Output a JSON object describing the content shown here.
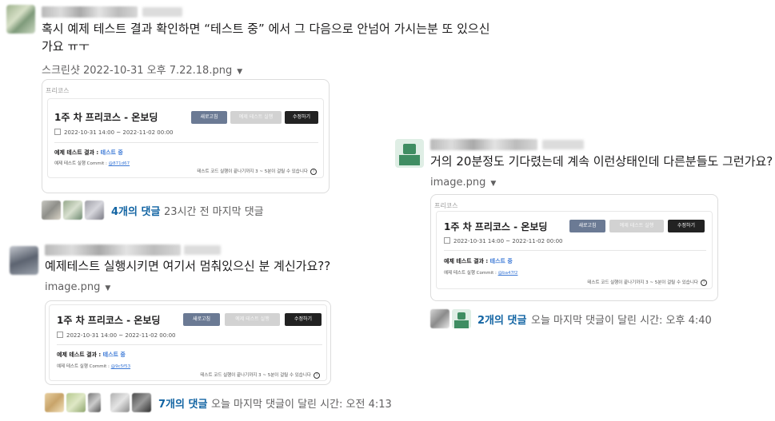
{
  "messages": [
    {
      "text_line1": "혹시 예제 테스트 결과 확인하면 “테스트 중” 에서 그 다음으로 안넘어 가시는분 또 있으신",
      "text_line2": "가요 ㅠㅜ",
      "file_name": "스크린샷 2022-10-31 오후 7.22.18.png",
      "card": {
        "section": "프리코스",
        "title": "1주 차 프리코스 - 온보딩",
        "btn_refresh": "새로고침",
        "btn_run": "예제 테스트 실행",
        "btn_edit": "수정하기",
        "date_range": "2022-10-31 14:00 ~ 2022-11-02 00:00",
        "result_label": "예제 테스트 결과 :",
        "result_value": "테스트 중",
        "commit_label": "예제 테스트 실행 Commit :",
        "commit_hash": "@871d67",
        "footer": "테스트 코드 실행이 끝나기까지 3 ~ 5분이 걸릴 수 있습니다"
      },
      "replies": {
        "count": "4개의 댓글",
        "meta": "23시간 전 마지막 댓글"
      }
    },
    {
      "text_line1": "예제테스트 실행시키면 여기서 멈춰있으신 분 계신가요??",
      "file_name": "image.png",
      "card": {
        "title": "1주 차 프리코스 - 온보딩",
        "btn_refresh": "새로고침",
        "btn_run": "예제 테스트 실행",
        "btn_edit": "수정하기",
        "date_range": "2022-10-31 14:00 ~ 2022-11-02 00:00",
        "result_label": "예제 테스트 결과 :",
        "result_value": "테스트 중",
        "commit_label": "예제 테스트 실행 Commit :",
        "commit_hash": "@9c5f53",
        "footer": "테스트 코드 실행이 끝나기까지 3 ~ 5분이 걸릴 수 있습니다"
      },
      "replies": {
        "count": "7개의 댓글",
        "meta": "오늘 마지막 댓글이 달린 시간: 오전 4:13"
      }
    },
    {
      "text_line1": "거의 20분정도 기다렸는데 계속 이런상태인데 다른분들도 그런가요?",
      "file_name": "image.png",
      "card": {
        "section": "프리코스",
        "title": "1주 차 프리코스 - 온보딩",
        "btn_refresh": "새로고침",
        "btn_run": "예제 테스트 실행",
        "btn_edit": "수정하기",
        "date_range": "2022-10-31 14:00 ~ 2022-11-02 00:00",
        "result_label": "예제 테스트 결과 :",
        "result_value": "테스트 중",
        "commit_label": "예제 테스트 실행 Commit :",
        "commit_hash": "@ba47f2",
        "footer": "테스트 코드 실행이 끝나기까지 3 ~ 5분이 걸릴 수 있습니다"
      },
      "replies": {
        "count": "2개의 댓글",
        "meta": "오늘 마지막 댓글이 달린 시간: 오후 4:40"
      }
    }
  ],
  "icons": {
    "calendar": "calendar-icon",
    "help": "help-circle-icon",
    "caret": "caret-down-icon"
  }
}
